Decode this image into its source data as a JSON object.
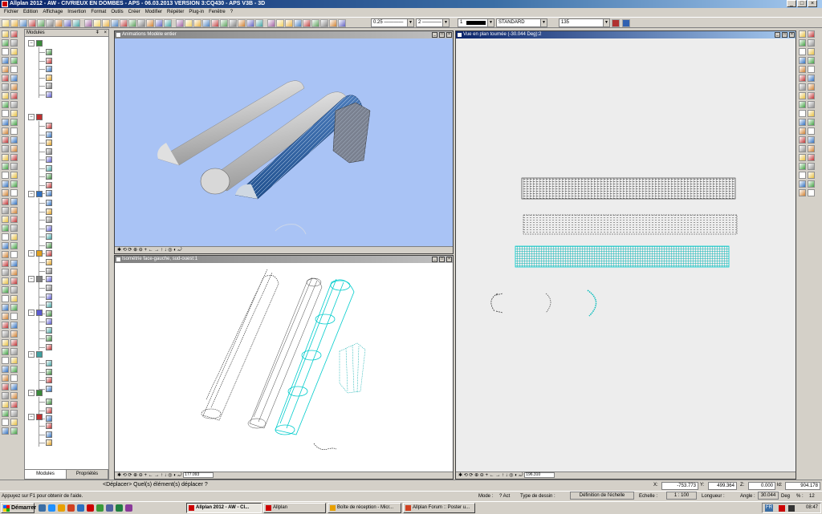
{
  "app": {
    "title": "Allplan 2012 - AW - CIVRIEUX EN DOMBES - APS - 06.03.2013 VERSION 3:CQ430 - APS V3B - 3D"
  },
  "menu": [
    "Fichier",
    "Edition",
    "Affichage",
    "Insertion",
    "Format",
    "Outils",
    "Créer",
    "Modifier",
    "Répéter",
    "Plug-in",
    "Fenêtre",
    "?"
  ],
  "toolbar": {
    "pen": "0.25 ————",
    "line": "2 ————",
    "color": "1",
    "layer": "STANDARD",
    "pattern": "135"
  },
  "panel": {
    "title": "Modules",
    "tabs": [
      "Modules",
      "Propriétés"
    ]
  },
  "viewports": {
    "anim": {
      "title": "Animations Modèle entier"
    },
    "iso": {
      "title": "Isométrie face-gauche, sud-ouest:1",
      "zoom": "177.093"
    },
    "plan": {
      "title": "Vue en plan tournée (-30.044 Deg):2",
      "zoom": "196.310"
    }
  },
  "prompt": {
    "text": "<Déplacer> Quel(s) élément(s) déplacer ?"
  },
  "coords": {
    "x_label": "X:",
    "x": "-753.773",
    "y_label": "Y:",
    "y": "499.364",
    "z_label": "Z:",
    "z": "0.000",
    "dl_label": "ld:",
    "dl": "904.178"
  },
  "status": {
    "help": "Appuyez sur F1 pour obtenir de l'aide.",
    "mode_label": "Mode :",
    "mode_value": "? Act",
    "type_label": "Type de dessin :",
    "scale_def": "Définition de l'échelle",
    "scale_label": "Echelle :",
    "scale": "1 : 100",
    "length_label": "Longueur :",
    "angle_label": "Angle :",
    "angle": "30.044",
    "unit": "Deg",
    "pct_label": "% :",
    "pct": "12"
  },
  "taskbar": {
    "start": "Démarrer",
    "items": [
      "Allplan 2012 - AW - CI...",
      "Allplan",
      "Boîte de réception - Micr...",
      "Allplan Forum :: Poster u..."
    ],
    "lang": "FR",
    "clock": "08:47"
  },
  "colors": {
    "title": "#0a246a",
    "cyan": "#00e0e0",
    "sky": "#a9c3f5"
  }
}
